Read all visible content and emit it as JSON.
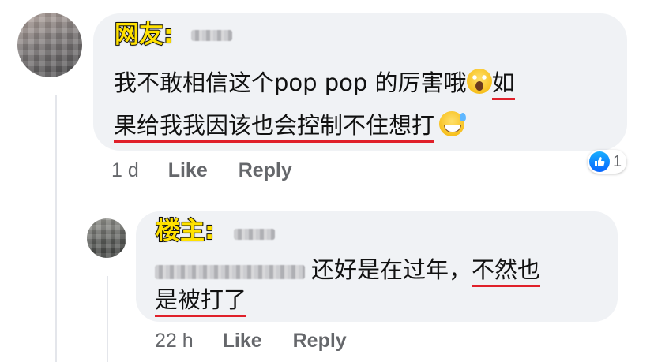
{
  "comment": {
    "tag": "网友:",
    "line1_prefix": "我不敢相信这个pop pop 的厉害哦",
    "line1_underlined": "如",
    "line2_underlined": "果给我我因该也会控制不住想打",
    "emoji_1": "face-screaming-icon",
    "emoji_2": "grinning-sweat-icon",
    "time": "1 d",
    "like_label": "Like",
    "reply_label": "Reply",
    "reaction_count": "1"
  },
  "reply": {
    "tag": "楼主:",
    "line1_text": "还好是在过年，",
    "line1_underlined": "不然也",
    "line2_underlined": "是被打了",
    "time": "22 h",
    "like_label": "Like",
    "reply_label": "Reply"
  },
  "colors": {
    "bubble": "#f0f2f5",
    "underline": "#e0202a",
    "tag_yellow": "#ffe100",
    "meta_gray": "#65676b",
    "like_blue": "#0866ff"
  }
}
